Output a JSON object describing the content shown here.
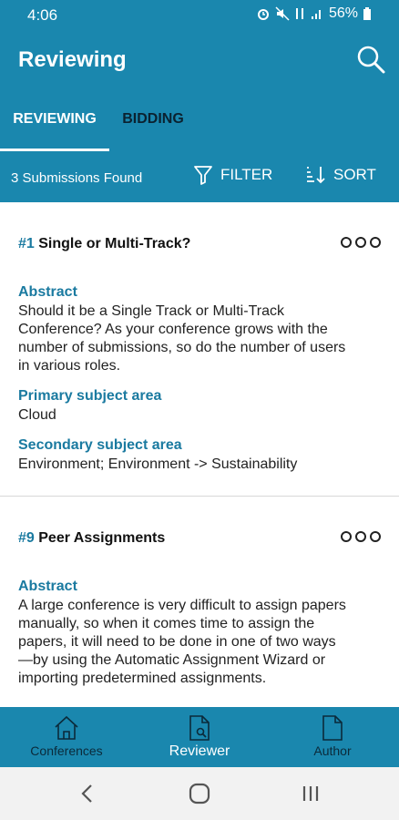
{
  "status": {
    "time": "4:06",
    "battery": "56%"
  },
  "appbar": {
    "title": "Reviewing",
    "search_icon": "search-icon"
  },
  "tabs": [
    {
      "label": "REVIEWING",
      "active": true
    },
    {
      "label": "BIDDING",
      "active": false
    }
  ],
  "filterbar": {
    "count": "3 Submissions Found",
    "filter_label": "FILTER",
    "sort_label": "SORT"
  },
  "submissions": [
    {
      "number": "#1",
      "title": "Single or Multi-Track?",
      "abstract_label": "Abstract",
      "abstract_lines": [
        "Should it be a Single Track or Multi-Track",
        "Conference?  As your conference grows with the",
        "number of submissions, so do the number of users",
        "in various roles."
      ],
      "primary_label": "Primary subject area",
      "primary_value": "Cloud",
      "secondary_label": "Secondary subject area",
      "secondary_value": "Environment; Environment -> Sustainability"
    },
    {
      "number": "#9",
      "title": "Peer Assignments",
      "abstract_label": "Abstract",
      "abstract_lines": [
        "A large conference is very difficult to assign papers",
        "manually, so when it comes time to assign the",
        "papers, it will need to be done in one of two ways",
        "—by using the Automatic Assignment Wizard or",
        "importing predetermined assignments."
      ]
    }
  ],
  "bottom_nav": [
    {
      "label": "Conferences",
      "icon": "home-icon",
      "active": false
    },
    {
      "label": "Reviewer",
      "icon": "document-search-icon",
      "active": true
    },
    {
      "label": "Author",
      "icon": "document-icon",
      "active": false
    }
  ],
  "colors": {
    "primary": "#1a87ae",
    "accent_text": "#1a7aa0"
  }
}
